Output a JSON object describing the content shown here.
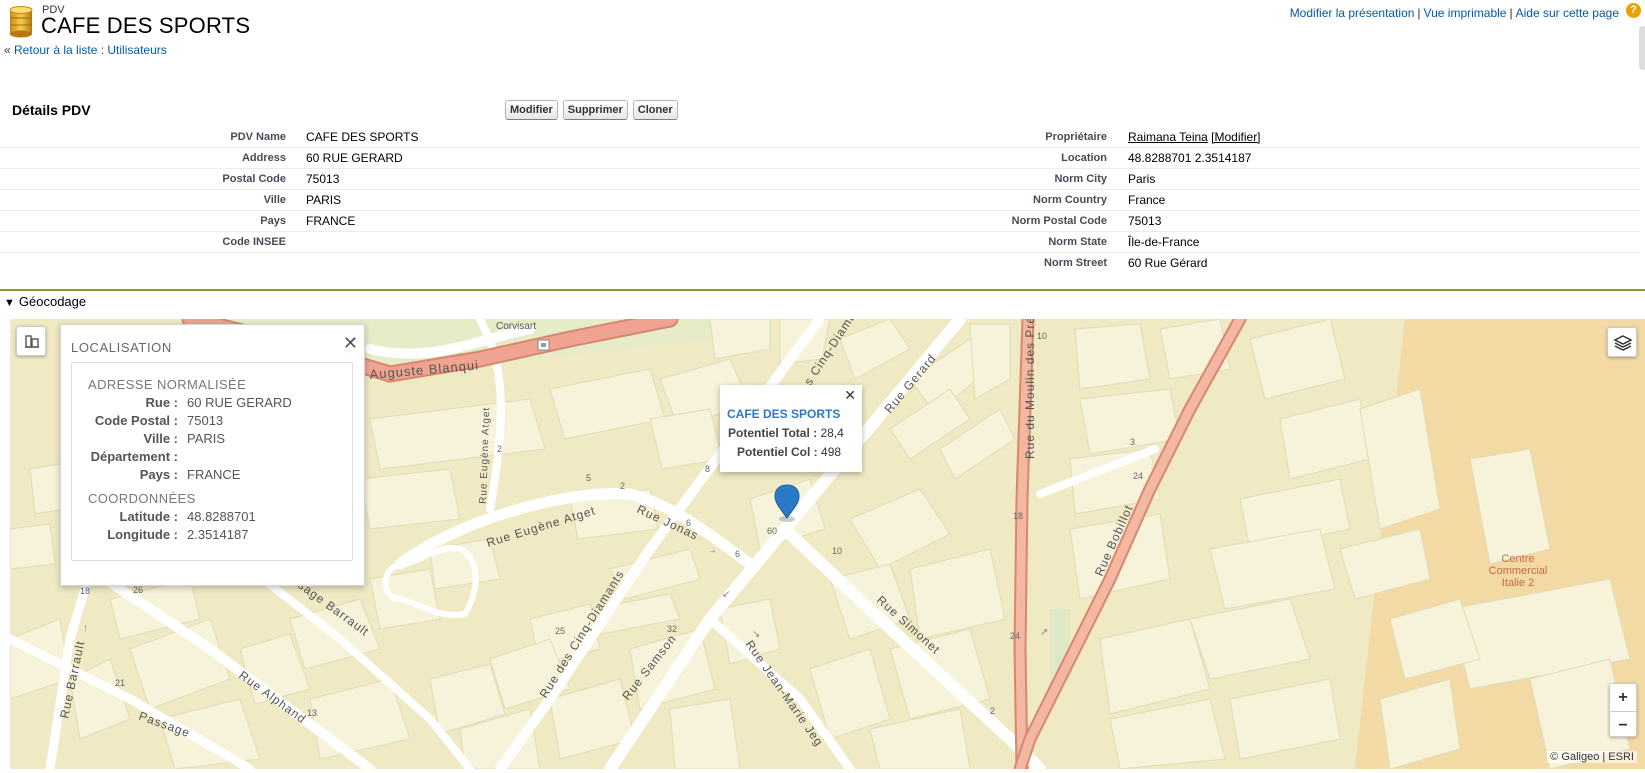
{
  "header": {
    "object_type": "PDV",
    "title": "CAFE DES SPORTS",
    "back_prefix": "« ",
    "back_link": "Retour à la liste : Utilisateurs",
    "links": [
      "Modifier la présentation",
      "Vue imprimable",
      "Aide sur cette page"
    ],
    "help_icon": "help-icon"
  },
  "detail": {
    "title": "Détails PDV",
    "buttons": [
      "Modifier",
      "Supprimer",
      "Cloner"
    ],
    "left_fields": [
      {
        "label": "PDV Name",
        "value": "CAFE DES SPORTS"
      },
      {
        "label": "Address",
        "value": "60 RUE GERARD"
      },
      {
        "label": "Postal Code",
        "value": "75013"
      },
      {
        "label": "Ville",
        "value": "PARIS"
      },
      {
        "label": "Pays",
        "value": "FRANCE"
      },
      {
        "label": "Code INSEE",
        "value": ""
      },
      {
        "label": "",
        "value": ""
      }
    ],
    "right_fields": [
      {
        "label": "Propriétaire",
        "owner": "Raimana Teina",
        "owner_action": "[Modifier]"
      },
      {
        "label": "Location",
        "value": "48.8288701 2.3514187"
      },
      {
        "label": "Norm City",
        "value": "Paris"
      },
      {
        "label": "Norm Country",
        "value": "France"
      },
      {
        "label": "Norm Postal Code",
        "value": "75013"
      },
      {
        "label": "Norm State",
        "value": "Île-de-France"
      },
      {
        "label": "Norm Street",
        "value": "60 Rue Gérard"
      }
    ]
  },
  "geocodage": {
    "section_title": "Géocodage",
    "localisation": {
      "title": "LOCALISATION",
      "address_title": "ADRESSE NORMALISÉE",
      "address": [
        {
          "label": "Rue :",
          "value": "60 RUE GERARD"
        },
        {
          "label": "Code Postal :",
          "value": "75013"
        },
        {
          "label": "Ville :",
          "value": "PARIS"
        },
        {
          "label": "Département :",
          "value": ""
        },
        {
          "label": "Pays :",
          "value": "FRANCE"
        }
      ],
      "coords_title": "COORDONNÉES",
      "coords": [
        {
          "label": "Latitude :",
          "value": "48.8288701"
        },
        {
          "label": "Longitude :",
          "value": "2.3514187"
        }
      ]
    },
    "popup": {
      "name": "CAFE DES SPORTS",
      "rows": [
        {
          "label": "Potentiel Total :",
          "value": "28,4"
        },
        {
          "label": "Potentiel Col :",
          "value": "498"
        }
      ]
    },
    "map_labels": {
      "corvisart": "Corvisart",
      "auguste_blanqui": "Auguste  Blanqui",
      "rue_eugene_atget_v": "Rue Eugène Atget",
      "rue_eugene_atget": "Rue Eugène Atget",
      "rue_jonas": "Rue Jonas",
      "passage_barrault": "Passage Barrault",
      "rue_barrault": "Rue Barrault",
      "rue_alphand": "Rue Alphand",
      "passage": "Passage",
      "rue_des_cinq_diamants": "Rue des Cinq-Diamants",
      "des_cinq_diamants_top": "des Cinq-Diamants",
      "rue_samson": "Rue Samson",
      "rue_jean_marie_jego": "Rue Jean-Marie Jeg",
      "rue_simonet": "Rue Simonet",
      "rue_gerard": "Rue Gerard",
      "rue_du_moulin_des_pres": "Rue du Moulin des Pré",
      "rue_bobillot": "Rue Bobillot",
      "centre_commercial": [
        "Centre",
        "Commercial",
        "Italie 2"
      ],
      "numbers": [
        "2",
        "5",
        "2",
        "8",
        "6",
        "6",
        "60",
        "10",
        "25",
        "32",
        "18",
        "26",
        "21",
        "13",
        "18",
        "24",
        "24",
        "10",
        "3",
        "2"
      ]
    },
    "attribution": "© Galigeo | ESRI",
    "controls": {
      "zoom_in": "+",
      "zoom_out": "−"
    },
    "icons": [
      "building-icon",
      "layers-icon",
      "map-marker-icon",
      "close-icon"
    ]
  },
  "colors": {
    "link": "#015ba7",
    "section_rule": "#8e9a1f",
    "map_bg": "#efe9c4",
    "building": "#f7f3da",
    "boulevard": "#efa390",
    "marker": "#2b78c4",
    "popup_title": "#2e78c7"
  }
}
